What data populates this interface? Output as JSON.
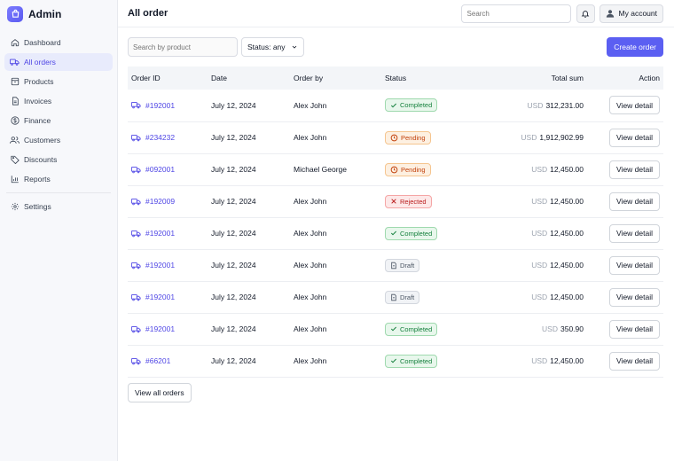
{
  "brand": {
    "name": "Admin"
  },
  "sidebar": {
    "items": [
      {
        "label": "Dashboard",
        "icon": "home-icon",
        "active": false
      },
      {
        "label": "All orders",
        "icon": "truck-icon",
        "active": true
      },
      {
        "label": "Products",
        "icon": "box-icon",
        "active": false
      },
      {
        "label": "Invoices",
        "icon": "file-icon",
        "active": false
      },
      {
        "label": "Finance",
        "icon": "dollar-icon",
        "active": false
      },
      {
        "label": "Customers",
        "icon": "users-icon",
        "active": false
      },
      {
        "label": "Discounts",
        "icon": "tag-icon",
        "active": false
      },
      {
        "label": "Reports",
        "icon": "chart-icon",
        "active": false
      }
    ],
    "settings": {
      "label": "Settings",
      "icon": "gear-icon"
    }
  },
  "header": {
    "title": "All order",
    "search_placeholder": "Search",
    "account_label": "My account"
  },
  "filters": {
    "search_placeholder": "Search by product",
    "status_label": "Status: any",
    "create_label": "Create order"
  },
  "table": {
    "columns": [
      "Order ID",
      "Date",
      "Order by",
      "Status",
      "Total sum",
      "Action"
    ],
    "rows": [
      {
        "id": "#192001",
        "date": "July 12, 2024",
        "by": "Alex John",
        "status": "Completed",
        "currency": "USD",
        "total": "312,231.00",
        "action": "View detail"
      },
      {
        "id": "#234232",
        "date": "July 12, 2024",
        "by": "Alex John",
        "status": "Pending",
        "currency": "USD",
        "total": "1,912,902.99",
        "action": "View detail"
      },
      {
        "id": "#092001",
        "date": "July 12, 2024",
        "by": "Michael George",
        "status": "Pending",
        "currency": "USD",
        "total": "12,450.00",
        "action": "View detail"
      },
      {
        "id": "#192009",
        "date": "July 12, 2024",
        "by": "Alex John",
        "status": "Rejected",
        "currency": "USD",
        "total": "12,450.00",
        "action": "View detail"
      },
      {
        "id": "#192001",
        "date": "July 12, 2024",
        "by": "Alex John",
        "status": "Completed",
        "currency": "USD",
        "total": "12,450.00",
        "action": "View detail"
      },
      {
        "id": "#192001",
        "date": "July 12, 2024",
        "by": "Alex John",
        "status": "Draft",
        "currency": "USD",
        "total": "12,450.00",
        "action": "View detail"
      },
      {
        "id": "#192001",
        "date": "July 12, 2024",
        "by": "Alex John",
        "status": "Draft",
        "currency": "USD",
        "total": "12,450.00",
        "action": "View detail"
      },
      {
        "id": "#192001",
        "date": "July 12, 2024",
        "by": "Alex John",
        "status": "Completed",
        "currency": "USD",
        "total": "350.90",
        "action": "View detail"
      },
      {
        "id": "#66201",
        "date": "July 12, 2024",
        "by": "Alex John",
        "status": "Completed",
        "currency": "USD",
        "total": "12,450.00",
        "action": "View detail"
      }
    ]
  },
  "footer": {
    "view_all_label": "View all orders"
  },
  "colors": {
    "accent": "#5b5ff2",
    "link": "#4f46e5",
    "completed": "#15803d",
    "pending": "#c2410c",
    "rejected": "#b91c1c",
    "draft": "#4b5563"
  }
}
